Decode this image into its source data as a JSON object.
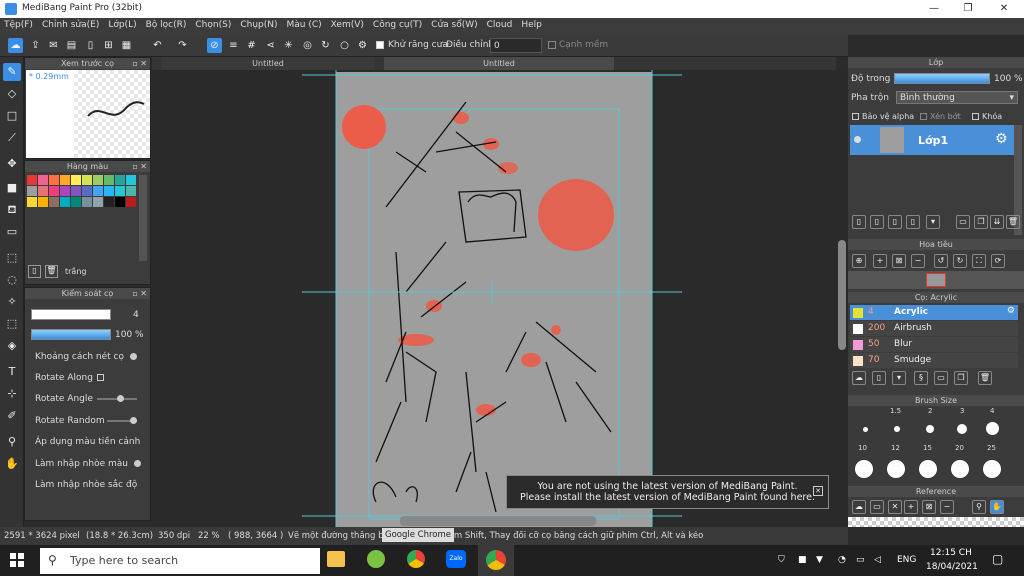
{
  "window": {
    "title": "MediBang Paint Pro (32bit)",
    "min": "—",
    "max": "❐",
    "close": "✕"
  },
  "menu": [
    "Tệp(F)",
    "Chỉnh sửa(E)",
    "Lớp(L)",
    "Bộ lọc(R)",
    "Chọn(S)",
    "Chụp(N)",
    "Màu (C)",
    "Xem(V)",
    "Công cụ(T)",
    "Cửa sổ(W)",
    "Cloud",
    "Help"
  ],
  "toolbar": {
    "antialias": "Khử răng cưa",
    "adjust_label": "Điều chỉnh",
    "adjust_value": "0",
    "smooth_edge": "Cạnh mềm"
  },
  "canvas": {
    "tabs": [
      "Untitled",
      "Untitled"
    ]
  },
  "preview": {
    "title": "Xem trước cọ",
    "size": "0.29mm"
  },
  "palette": {
    "title": "Hàng màu",
    "label": "trắng",
    "colors": [
      "#e53935",
      "#f06292",
      "#ff7043",
      "#ffa726",
      "#ffee58",
      "#d4e157",
      "#9ccc65",
      "#66bb6a",
      "#26a69a",
      "#26c6da",
      "#9e9e9e",
      "#e57373",
      "#ec407a",
      "#ab47bc",
      "#7e57c2",
      "#5c6bc0",
      "#42a5f5",
      "#29b6f6",
      "#26c6da",
      "#4db6ac",
      "#fdd835",
      "#ffb300",
      "#8d6e63",
      "#00acc1",
      "#00897b",
      "#78909c",
      "#90a4ae",
      "#212121",
      "#000000",
      "#b71c1c"
    ]
  },
  "brush_control": {
    "title": "Kiểm soát cọ",
    "size": "4",
    "opacity": "100 %",
    "opacity_level": 1.0,
    "options": [
      "Khoảng cách nét cọ",
      "Rotate Along",
      "Rotate Angle",
      "Rotate Random",
      "Áp dụng màu tiền cảnh",
      "Làm nhập nhòe màu",
      "Làm nhập nhòe sắc độ"
    ]
  },
  "layer": {
    "title": "Lớp",
    "opacity_label": "Độ trong",
    "opacity": "100 %",
    "blend_label": "Pha trộn",
    "blend": "Bình thường",
    "protect_alpha": "Bảo vệ alpha",
    "clipping": "Xén bớt",
    "lock": "Khóa",
    "layer_name": "Lớp1"
  },
  "navigator": {
    "title": "Hoa tiêu"
  },
  "brush": {
    "title": "Cọ: Acrylic",
    "items": [
      {
        "size": "4",
        "name": "Acrylic",
        "color": "#e8e030",
        "selected": true
      },
      {
        "size": "200",
        "name": "Airbrush",
        "color": "#ffffff",
        "selected": false
      },
      {
        "size": "50",
        "name": "Blur",
        "color": "#f59ad8",
        "selected": false
      },
      {
        "size": "70",
        "name": "Smudge",
        "color": "#fde0c8",
        "selected": false
      }
    ]
  },
  "brush_size": {
    "title": "Brush Size",
    "labels_top": [
      "1.5",
      "2",
      "3",
      "4"
    ],
    "labels_mid": [
      "10",
      "12",
      "15",
      "20",
      "25"
    ]
  },
  "reference": {
    "title": "Reference"
  },
  "notification": {
    "line1": "You are not using the latest version of MediBang Paint.",
    "line2": "Please install the latest version of MediBang Paint found here.",
    "close": "✕"
  },
  "status": {
    "dims": "2591 * 3624 pixel",
    "physical": "(18.8 * 26.3cm)",
    "dpi": "350 dpi",
    "zoom": "22 %",
    "coords": "( 988, 3664 )",
    "hint": "Vẽ một đường thẳng bằng cách giữ phím Shift, Thay đổi cỡ cọ bằng cách giữ phím Ctrl, Alt và kéo",
    "tooltip": "Google Chrome"
  },
  "taskbar": {
    "search_placeholder": "Type here to search",
    "lang": "ENG",
    "time": "12:15 CH",
    "date": "18/04/2021"
  }
}
